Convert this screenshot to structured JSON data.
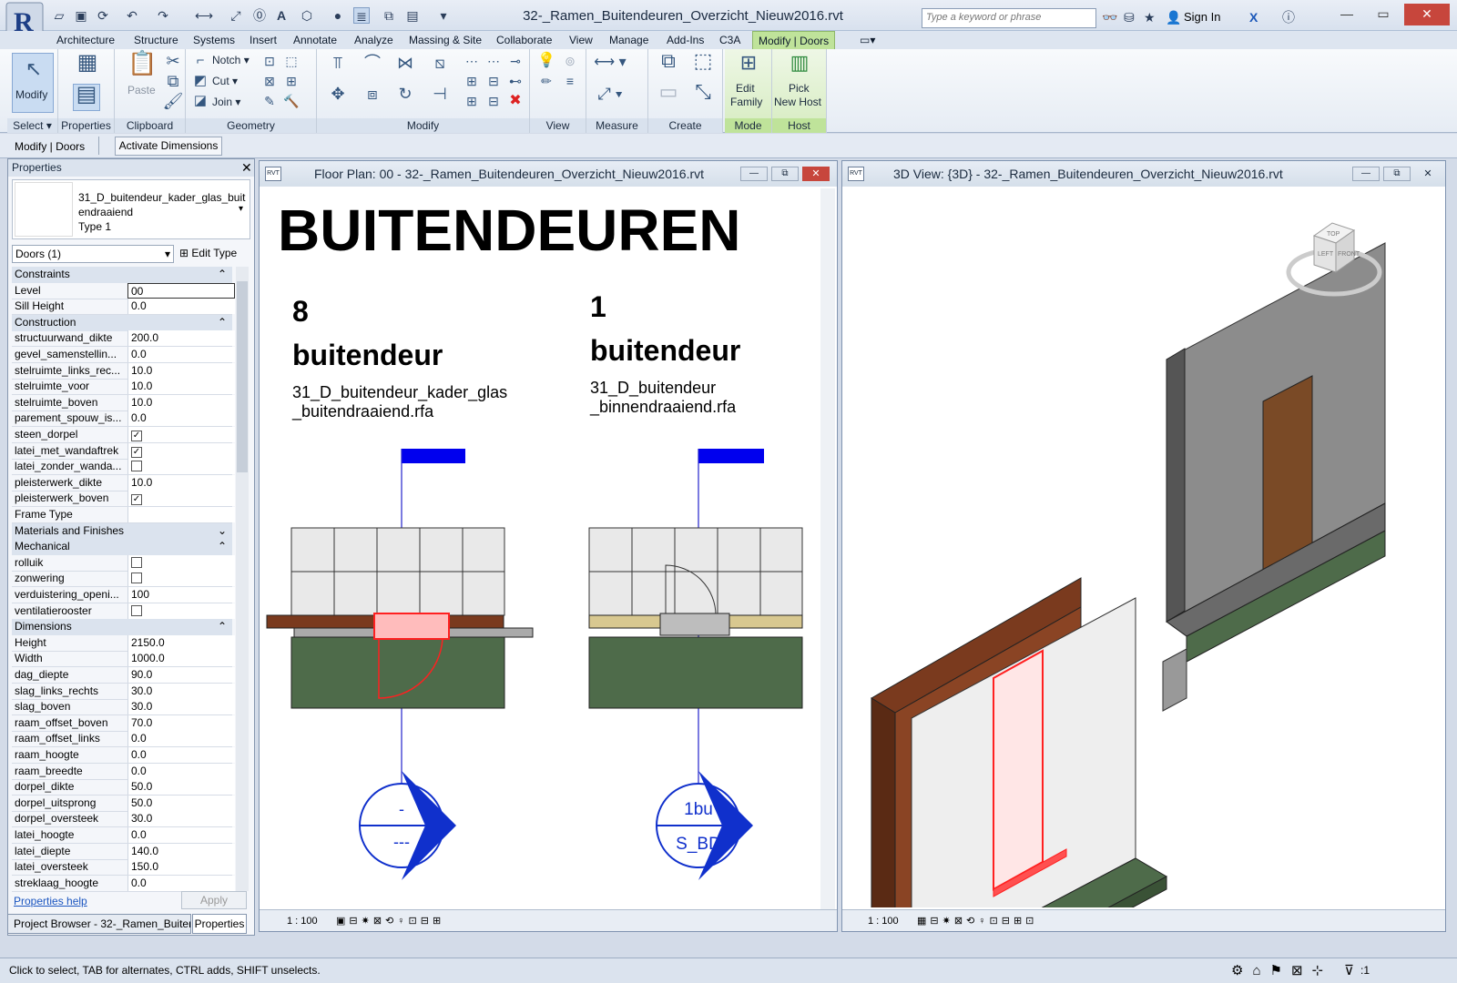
{
  "window": {
    "title": "32-_Ramen_Buitendeuren_Overzicht_Nieuw2016.rvt",
    "search_placeholder": "Type a keyword or phrase",
    "sign_in": "Sign In"
  },
  "tabs": [
    "Architecture",
    "Structure",
    "Systems",
    "Insert",
    "Annotate",
    "Analyze",
    "Massing & Site",
    "Collaborate",
    "View",
    "Manage",
    "Add-Ins",
    "C3A",
    "Modify | Doors"
  ],
  "ribbon": {
    "select": {
      "modify": "Modify",
      "label": "Select"
    },
    "properties": {
      "label": "Properties"
    },
    "clipboard": {
      "paste": "Paste",
      "label": "Clipboard"
    },
    "geometry": {
      "notch": "Notch",
      "cut": "Cut",
      "join": "Join",
      "label": "Geometry"
    },
    "modify": {
      "label": "Modify"
    },
    "view": {
      "label": "View"
    },
    "measure": {
      "label": "Measure"
    },
    "create": {
      "label": "Create"
    },
    "mode": {
      "edit_family_1": "Edit",
      "edit_family_2": "Family",
      "label": "Mode"
    },
    "host": {
      "pick_1": "Pick",
      "pick_2": "New Host",
      "label": "Host"
    }
  },
  "optbar": {
    "context": "Modify | Doors",
    "activate": "Activate Dimensions"
  },
  "properties": {
    "title": "Properties",
    "type_name_1": "31_D_buitendeur_kader_glas_buit",
    "type_name_2": "endraaiend",
    "type_name_3": "Type 1",
    "selector": "Doors (1)",
    "edit_type": "Edit Type",
    "apply": "Apply",
    "help": "Properties help",
    "rows": [
      {
        "type": "cat",
        "label": "Constraints",
        "icon": "collapse"
      },
      {
        "k": "Level",
        "v": "00"
      },
      {
        "k": "Sill Height",
        "v": "0.0"
      },
      {
        "type": "cat",
        "label": "Construction",
        "icon": "collapse"
      },
      {
        "k": "structuurwand_dikte",
        "v": "200.0"
      },
      {
        "k": "gevel_samenstellin...",
        "v": "0.0"
      },
      {
        "k": "stelruimte_links_rec...",
        "v": "10.0"
      },
      {
        "k": "stelruimte_voor",
        "v": "10.0"
      },
      {
        "k": "stelruimte_boven",
        "v": "10.0"
      },
      {
        "k": "parement_spouw_is...",
        "v": "0.0"
      },
      {
        "k": "steen_dorpel",
        "v": "",
        "c": true
      },
      {
        "k": "latei_met_wandaftrek",
        "v": "",
        "c": true
      },
      {
        "k": "latei_zonder_wanda...",
        "v": "",
        "c": false
      },
      {
        "k": "pleisterwerk_dikte",
        "v": "10.0"
      },
      {
        "k": "pleisterwerk_boven",
        "v": "",
        "c": true
      },
      {
        "k": "Frame Type",
        "v": ""
      },
      {
        "type": "cat",
        "label": "Materials and Finishes",
        "icon": "expand"
      },
      {
        "type": "cat",
        "label": "Mechanical",
        "icon": "collapse"
      },
      {
        "k": "rolluik",
        "v": "",
        "c": false
      },
      {
        "k": "zonwering",
        "v": "",
        "c": false
      },
      {
        "k": "verduistering_openi...",
        "v": "100"
      },
      {
        "k": "ventilatierooster",
        "v": "",
        "c": false
      },
      {
        "type": "cat",
        "label": "Dimensions",
        "icon": "collapse"
      },
      {
        "k": "Height",
        "v": "2150.0"
      },
      {
        "k": "Width",
        "v": "1000.0"
      },
      {
        "k": "dag_diepte",
        "v": "90.0"
      },
      {
        "k": "slag_links_rechts",
        "v": "30.0"
      },
      {
        "k": "slag_boven",
        "v": "30.0"
      },
      {
        "k": "raam_offset_boven",
        "v": "70.0"
      },
      {
        "k": "raam_offset_links",
        "v": "0.0"
      },
      {
        "k": "raam_hoogte",
        "v": "0.0"
      },
      {
        "k": "raam_breedte",
        "v": "0.0"
      },
      {
        "k": "dorpel_dikte",
        "v": "50.0"
      },
      {
        "k": "dorpel_uitsprong",
        "v": "50.0"
      },
      {
        "k": "dorpel_oversteek",
        "v": "30.0"
      },
      {
        "k": "latei_hoogte",
        "v": "0.0"
      },
      {
        "k": "latei_diepte",
        "v": "140.0"
      },
      {
        "k": "latei_oversteek",
        "v": "150.0"
      },
      {
        "k": "streklaag_hoogte",
        "v": "0.0"
      }
    ],
    "bottom_tabs": [
      "Project Browser - 32-_Ramen_Buiten...",
      "Properties"
    ]
  },
  "floorplan": {
    "title": "Floor Plan: 00 - 32-_Ramen_Buitendeuren_Overzicht_Nieuw2016.rvt",
    "heading": "BUITENDEUREN",
    "left": {
      "count": "8",
      "kind": "buitendeur",
      "file_1": "31_D_buitendeur_kader_glas",
      "file_2": "_buitendraaiend.rfa",
      "tag_top": "-",
      "tag_bottom": "---"
    },
    "right": {
      "count": "1",
      "kind": "buitendeur",
      "file_1": "31_D_buitendeur",
      "file_2": "_binnendraaiend.rfa",
      "tag_top": "1bu",
      "tag_bottom": "S_BD"
    },
    "scale": "1 : 100"
  },
  "view3d": {
    "title": "3D View: {3D} - 32-_Ramen_Buitendeuren_Overzicht_Nieuw2016.rvt",
    "scale": "1 : 100",
    "cube_top": "TOP",
    "cube_left": "LEFT",
    "cube_front": "FRONT"
  },
  "status": {
    "text": "Click to select, TAB for alternates, CTRL adds, SHIFT unselects.",
    "filter_count": ":1"
  },
  "colors": {
    "ribbon_green": "#bfe39a",
    "tag_blue": "#0000ee",
    "ground_green": "#4e6b4a",
    "brick_brown": "#7a3a1e",
    "selection_red": "#ff3030"
  }
}
